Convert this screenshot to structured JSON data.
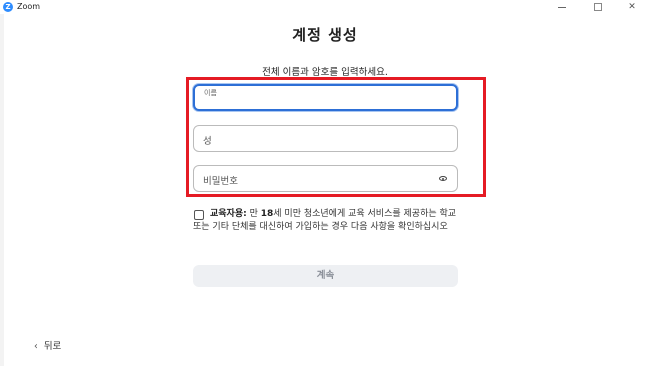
{
  "window": {
    "app_name": "Zoom",
    "logo_letter": "Z"
  },
  "form": {
    "title": "계정 생성",
    "subtitle": "전체 이름과 암호를 입력하세요.",
    "first_name_label": "이름",
    "last_name_label": "성",
    "password_label": "비밀번호"
  },
  "consent": {
    "bold_prefix": "교육자용:",
    "text_before_age": " 만 ",
    "age": "18",
    "text_after_age": "세 미만 청소년에게 교육 서비스를 제공하는 학교 또는 기타 단체를 대신하여 가입하는 경우 다음 사항을 확인하십시오",
    "checked": false
  },
  "actions": {
    "continue_label": "계속",
    "back_label": "뒤로"
  },
  "icons": {
    "app": "zoom-logo-icon",
    "password_toggle": "eye-icon",
    "back": "chevron-left-icon"
  },
  "colors": {
    "highlight": "#e51b24",
    "accent": "#2d6fd6",
    "zoom_blue": "#2d8cff"
  }
}
